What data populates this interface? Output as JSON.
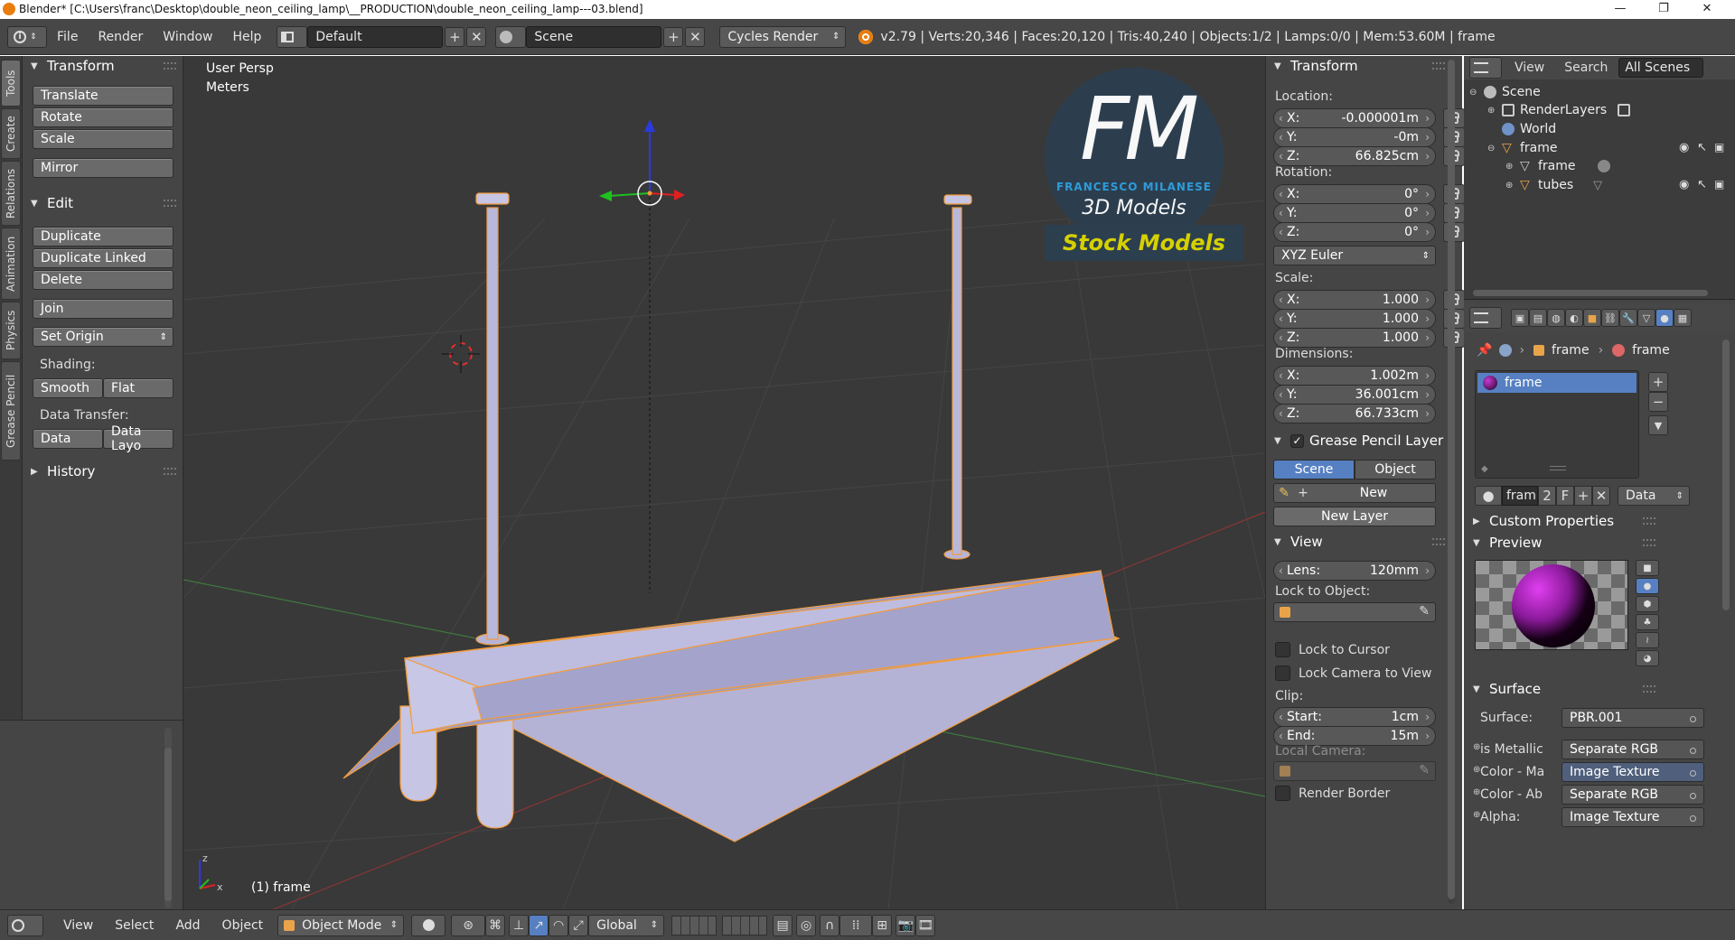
{
  "window": {
    "title": "Blender* [C:\\Users\\franc\\Desktop\\double_neon_ceiling_lamp\\__PRODUCTION\\double_neon_ceiling_lamp---03.blend]",
    "minimize": "—",
    "maximize": "❐",
    "close": "✕"
  },
  "header": {
    "menus": [
      "File",
      "Render",
      "Window",
      "Help"
    ],
    "layout": "Default",
    "scene": "Scene",
    "engine": "Cycles Render",
    "stats": "v2.79 | Verts:20,346 | Faces:20,120 | Tris:40,240 | Objects:1/2 | Lamps:0/0 | Mem:53.60M | frame"
  },
  "left_tabs": [
    "Tools",
    "Create",
    "Relations",
    "Animation",
    "Physics",
    "Grease Pencil"
  ],
  "tool_shelf": {
    "transform_title": "Transform",
    "transform_buttons": [
      "Translate",
      "Rotate",
      "Scale",
      "Mirror"
    ],
    "edit_title": "Edit",
    "edit_buttons": [
      "Duplicate",
      "Duplicate Linked",
      "Delete",
      "Join"
    ],
    "set_origin": "Set Origin",
    "shading_label": "Shading:",
    "smooth": "Smooth",
    "flat": "Flat",
    "data_transfer_label": "Data Transfer:",
    "data": "Data",
    "data_layout": "Data Layo",
    "history_title": "History"
  },
  "viewport": {
    "view_name": "User Persp",
    "units": "Meters",
    "object_label": "(1) frame",
    "watermark": {
      "letters": "FM",
      "author": "FRANCESCO MILANESE",
      "subtitle": "3D Models",
      "banner": "Stock Models"
    },
    "axis_x": "x",
    "axis_z": "z"
  },
  "n_panel": {
    "transform_title": "Transform",
    "location_label": "Location:",
    "location": [
      {
        "axis": "X:",
        "value": "-0.000001m"
      },
      {
        "axis": "Y:",
        "value": "-0m"
      },
      {
        "axis": "Z:",
        "value": "66.825cm"
      }
    ],
    "rotation_label": "Rotation:",
    "rotation": [
      {
        "axis": "X:",
        "value": "0°"
      },
      {
        "axis": "Y:",
        "value": "0°"
      },
      {
        "axis": "Z:",
        "value": "0°"
      }
    ],
    "rotation_mode": "XYZ Euler",
    "scale_label": "Scale:",
    "scale": [
      {
        "axis": "X:",
        "value": "1.000"
      },
      {
        "axis": "Y:",
        "value": "1.000"
      },
      {
        "axis": "Z:",
        "value": "1.000"
      }
    ],
    "dimensions_label": "Dimensions:",
    "dimensions": [
      {
        "axis": "X:",
        "value": "1.002m"
      },
      {
        "axis": "Y:",
        "value": "36.001cm"
      },
      {
        "axis": "Z:",
        "value": "66.733cm"
      }
    ],
    "grease_title": "Grease Pencil Layer",
    "grease_scene": "Scene",
    "grease_object": "Object",
    "grease_new": "New",
    "grease_new_layer": "New Layer",
    "view_title": "View",
    "lens_label": "Lens:",
    "lens_value": "120mm",
    "lock_object_label": "Lock to Object:",
    "lock_cursor": "Lock to Cursor",
    "lock_camera": "Lock Camera to View",
    "clip_label": "Clip:",
    "clip_start_label": "Start:",
    "clip_start": "1cm",
    "clip_end_label": "End:",
    "clip_end": "15m",
    "local_camera": "Local Camera:",
    "render_border": "Render Border"
  },
  "outliner": {
    "view": "View",
    "search": "Search",
    "filter": "All Scenes",
    "items": [
      {
        "label": "Scene"
      },
      {
        "label": "RenderLayers"
      },
      {
        "label": "World"
      },
      {
        "label": "frame"
      },
      {
        "label": "frame"
      },
      {
        "label": "tubes"
      }
    ]
  },
  "properties": {
    "breadcrumb_object": "frame",
    "breadcrumb_material": "frame",
    "material_slot": "frame",
    "mat_name": "fram",
    "mat_users": "2",
    "mat_fake": "F",
    "mat_link": "Data",
    "custom_props": "Custom Properties",
    "preview": "Preview",
    "surface_title": "Surface",
    "surface_label": "Surface:",
    "surface_value": "PBR.001",
    "rows": [
      {
        "label": "is Metallic",
        "value": "Separate RGB"
      },
      {
        "label": "Color - Ma",
        "value": "Image Texture"
      },
      {
        "label": "Color - Ab",
        "value": "Separate RGB"
      },
      {
        "label": "Alpha:",
        "value": "Image Texture"
      }
    ]
  },
  "bottom_bar": {
    "menus": [
      "View",
      "Select",
      "Add",
      "Object"
    ],
    "mode": "Object Mode",
    "orientation": "Global"
  },
  "colors": {
    "background": "#393939",
    "panel": "#454545",
    "selected": "#5680c2",
    "mesh": "#a9a8cd",
    "selection_outline": "#f39c3c",
    "watermark_bg": "#2c3f4f",
    "watermark_blue": "#2e9fe0",
    "banner_text": "#d6d000"
  }
}
